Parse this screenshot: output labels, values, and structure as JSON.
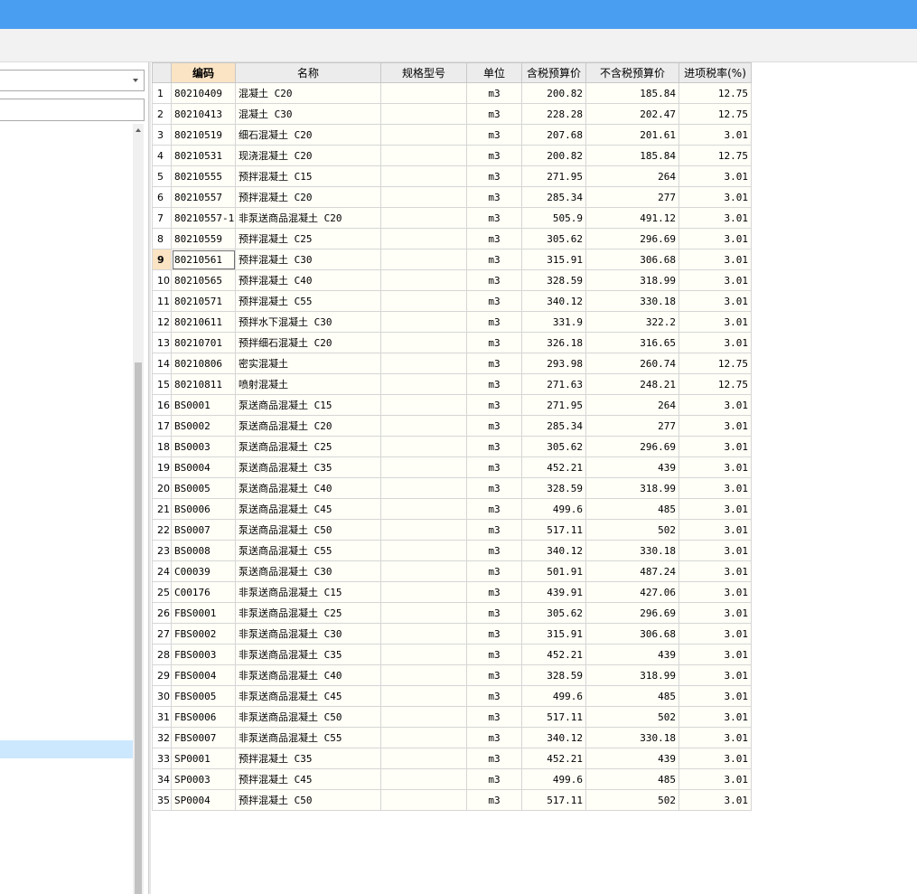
{
  "grid": {
    "headers": [
      "",
      "编码",
      "名称",
      "规格型号",
      "单位",
      "含税预算价",
      "不含税预算价",
      "进项税率(%)"
    ],
    "active_row": 9,
    "rows": [
      {
        "n": "1",
        "code": "80210409",
        "name": "混凝土 C20",
        "spec": "",
        "unit": "m3",
        "tax_price": "200.82",
        "notax_price": "185.84",
        "rate": "12.75"
      },
      {
        "n": "2",
        "code": "80210413",
        "name": "混凝土 C30",
        "spec": "",
        "unit": "m3",
        "tax_price": "228.28",
        "notax_price": "202.47",
        "rate": "12.75"
      },
      {
        "n": "3",
        "code": "80210519",
        "name": "细石混凝土 C20",
        "spec": "",
        "unit": "m3",
        "tax_price": "207.68",
        "notax_price": "201.61",
        "rate": "3.01"
      },
      {
        "n": "4",
        "code": "80210531",
        "name": "现浇混凝土 C20",
        "spec": "",
        "unit": "m3",
        "tax_price": "200.82",
        "notax_price": "185.84",
        "rate": "12.75"
      },
      {
        "n": "5",
        "code": "80210555",
        "name": "预拌混凝土 C15",
        "spec": "",
        "unit": "m3",
        "tax_price": "271.95",
        "notax_price": "264",
        "rate": "3.01"
      },
      {
        "n": "6",
        "code": "80210557",
        "name": "预拌混凝土 C20",
        "spec": "",
        "unit": "m3",
        "tax_price": "285.34",
        "notax_price": "277",
        "rate": "3.01"
      },
      {
        "n": "7",
        "code": "80210557-1",
        "name": "非泵送商品混凝土 C20",
        "spec": "",
        "unit": "m3",
        "tax_price": "505.9",
        "notax_price": "491.12",
        "rate": "3.01"
      },
      {
        "n": "8",
        "code": "80210559",
        "name": "预拌混凝土 C25",
        "spec": "",
        "unit": "m3",
        "tax_price": "305.62",
        "notax_price": "296.69",
        "rate": "3.01"
      },
      {
        "n": "9",
        "code": "80210561",
        "name": "预拌混凝土 C30",
        "spec": "",
        "unit": "m3",
        "tax_price": "315.91",
        "notax_price": "306.68",
        "rate": "3.01"
      },
      {
        "n": "10",
        "code": "80210565",
        "name": "预拌混凝土 C40",
        "spec": "",
        "unit": "m3",
        "tax_price": "328.59",
        "notax_price": "318.99",
        "rate": "3.01"
      },
      {
        "n": "11",
        "code": "80210571",
        "name": "预拌混凝土 C55",
        "spec": "",
        "unit": "m3",
        "tax_price": "340.12",
        "notax_price": "330.18",
        "rate": "3.01"
      },
      {
        "n": "12",
        "code": "80210611",
        "name": "预拌水下混凝土 C30",
        "spec": "",
        "unit": "m3",
        "tax_price": "331.9",
        "notax_price": "322.2",
        "rate": "3.01"
      },
      {
        "n": "13",
        "code": "80210701",
        "name": "预拌细石混凝土 C20",
        "spec": "",
        "unit": "m3",
        "tax_price": "326.18",
        "notax_price": "316.65",
        "rate": "3.01"
      },
      {
        "n": "14",
        "code": "80210806",
        "name": "密实混凝土",
        "spec": "",
        "unit": "m3",
        "tax_price": "293.98",
        "notax_price": "260.74",
        "rate": "12.75"
      },
      {
        "n": "15",
        "code": "80210811",
        "name": "喷射混凝土",
        "spec": "",
        "unit": "m3",
        "tax_price": "271.63",
        "notax_price": "248.21",
        "rate": "12.75"
      },
      {
        "n": "16",
        "code": "BS0001",
        "name": "泵送商品混凝土 C15",
        "spec": "",
        "unit": "m3",
        "tax_price": "271.95",
        "notax_price": "264",
        "rate": "3.01"
      },
      {
        "n": "17",
        "code": "BS0002",
        "name": "泵送商品混凝土 C20",
        "spec": "",
        "unit": "m3",
        "tax_price": "285.34",
        "notax_price": "277",
        "rate": "3.01"
      },
      {
        "n": "18",
        "code": "BS0003",
        "name": "泵送商品混凝土 C25",
        "spec": "",
        "unit": "m3",
        "tax_price": "305.62",
        "notax_price": "296.69",
        "rate": "3.01"
      },
      {
        "n": "19",
        "code": "BS0004",
        "name": "泵送商品混凝土 C35",
        "spec": "",
        "unit": "m3",
        "tax_price": "452.21",
        "notax_price": "439",
        "rate": "3.01"
      },
      {
        "n": "20",
        "code": "BS0005",
        "name": "泵送商品混凝土 C40",
        "spec": "",
        "unit": "m3",
        "tax_price": "328.59",
        "notax_price": "318.99",
        "rate": "3.01"
      },
      {
        "n": "21",
        "code": "BS0006",
        "name": "泵送商品混凝土 C45",
        "spec": "",
        "unit": "m3",
        "tax_price": "499.6",
        "notax_price": "485",
        "rate": "3.01"
      },
      {
        "n": "22",
        "code": "BS0007",
        "name": "泵送商品混凝土 C50",
        "spec": "",
        "unit": "m3",
        "tax_price": "517.11",
        "notax_price": "502",
        "rate": "3.01"
      },
      {
        "n": "23",
        "code": "BS0008",
        "name": "泵送商品混凝土 C55",
        "spec": "",
        "unit": "m3",
        "tax_price": "340.12",
        "notax_price": "330.18",
        "rate": "3.01"
      },
      {
        "n": "24",
        "code": "C00039",
        "name": "泵送商品混凝土 C30",
        "spec": "",
        "unit": "m3",
        "tax_price": "501.91",
        "notax_price": "487.24",
        "rate": "3.01"
      },
      {
        "n": "25",
        "code": "C00176",
        "name": "非泵送商品混凝土 C15",
        "spec": "",
        "unit": "m3",
        "tax_price": "439.91",
        "notax_price": "427.06",
        "rate": "3.01"
      },
      {
        "n": "26",
        "code": "FBS0001",
        "name": "非泵送商品混凝土 C25",
        "spec": "",
        "unit": "m3",
        "tax_price": "305.62",
        "notax_price": "296.69",
        "rate": "3.01"
      },
      {
        "n": "27",
        "code": "FBS0002",
        "name": "非泵送商品混凝土 C30",
        "spec": "",
        "unit": "m3",
        "tax_price": "315.91",
        "notax_price": "306.68",
        "rate": "3.01"
      },
      {
        "n": "28",
        "code": "FBS0003",
        "name": "非泵送商品混凝土 C35",
        "spec": "",
        "unit": "m3",
        "tax_price": "452.21",
        "notax_price": "439",
        "rate": "3.01"
      },
      {
        "n": "29",
        "code": "FBS0004",
        "name": "非泵送商品混凝土 C40",
        "spec": "",
        "unit": "m3",
        "tax_price": "328.59",
        "notax_price": "318.99",
        "rate": "3.01"
      },
      {
        "n": "30",
        "code": "FBS0005",
        "name": "非泵送商品混凝土 C45",
        "spec": "",
        "unit": "m3",
        "tax_price": "499.6",
        "notax_price": "485",
        "rate": "3.01"
      },
      {
        "n": "31",
        "code": "FBS0006",
        "name": "非泵送商品混凝土 C50",
        "spec": "",
        "unit": "m3",
        "tax_price": "517.11",
        "notax_price": "502",
        "rate": "3.01"
      },
      {
        "n": "32",
        "code": "FBS0007",
        "name": "非泵送商品混凝土 C55",
        "spec": "",
        "unit": "m3",
        "tax_price": "340.12",
        "notax_price": "330.18",
        "rate": "3.01"
      },
      {
        "n": "33",
        "code": "SP0001",
        "name": "预拌混凝土 C35",
        "spec": "",
        "unit": "m3",
        "tax_price": "452.21",
        "notax_price": "439",
        "rate": "3.01"
      },
      {
        "n": "34",
        "code": "SP0003",
        "name": "预拌混凝土 C45",
        "spec": "",
        "unit": "m3",
        "tax_price": "499.6",
        "notax_price": "485",
        "rate": "3.01"
      },
      {
        "n": "35",
        "code": "SP0004",
        "name": "预拌混凝土 C50",
        "spec": "",
        "unit": "m3",
        "tax_price": "517.11",
        "notax_price": "502",
        "rate": "3.01"
      }
    ]
  }
}
